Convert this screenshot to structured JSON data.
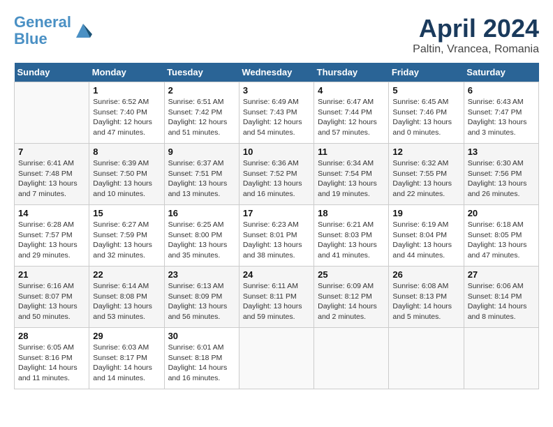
{
  "header": {
    "logo_line1": "General",
    "logo_line2": "Blue",
    "month": "April 2024",
    "location": "Paltin, Vrancea, Romania"
  },
  "weekdays": [
    "Sunday",
    "Monday",
    "Tuesday",
    "Wednesday",
    "Thursday",
    "Friday",
    "Saturday"
  ],
  "weeks": [
    [
      {
        "day": "",
        "info": ""
      },
      {
        "day": "1",
        "info": "Sunrise: 6:52 AM\nSunset: 7:40 PM\nDaylight: 12 hours\nand 47 minutes."
      },
      {
        "day": "2",
        "info": "Sunrise: 6:51 AM\nSunset: 7:42 PM\nDaylight: 12 hours\nand 51 minutes."
      },
      {
        "day": "3",
        "info": "Sunrise: 6:49 AM\nSunset: 7:43 PM\nDaylight: 12 hours\nand 54 minutes."
      },
      {
        "day": "4",
        "info": "Sunrise: 6:47 AM\nSunset: 7:44 PM\nDaylight: 12 hours\nand 57 minutes."
      },
      {
        "day": "5",
        "info": "Sunrise: 6:45 AM\nSunset: 7:46 PM\nDaylight: 13 hours\nand 0 minutes."
      },
      {
        "day": "6",
        "info": "Sunrise: 6:43 AM\nSunset: 7:47 PM\nDaylight: 13 hours\nand 3 minutes."
      }
    ],
    [
      {
        "day": "7",
        "info": "Sunrise: 6:41 AM\nSunset: 7:48 PM\nDaylight: 13 hours\nand 7 minutes."
      },
      {
        "day": "8",
        "info": "Sunrise: 6:39 AM\nSunset: 7:50 PM\nDaylight: 13 hours\nand 10 minutes."
      },
      {
        "day": "9",
        "info": "Sunrise: 6:37 AM\nSunset: 7:51 PM\nDaylight: 13 hours\nand 13 minutes."
      },
      {
        "day": "10",
        "info": "Sunrise: 6:36 AM\nSunset: 7:52 PM\nDaylight: 13 hours\nand 16 minutes."
      },
      {
        "day": "11",
        "info": "Sunrise: 6:34 AM\nSunset: 7:54 PM\nDaylight: 13 hours\nand 19 minutes."
      },
      {
        "day": "12",
        "info": "Sunrise: 6:32 AM\nSunset: 7:55 PM\nDaylight: 13 hours\nand 22 minutes."
      },
      {
        "day": "13",
        "info": "Sunrise: 6:30 AM\nSunset: 7:56 PM\nDaylight: 13 hours\nand 26 minutes."
      }
    ],
    [
      {
        "day": "14",
        "info": "Sunrise: 6:28 AM\nSunset: 7:57 PM\nDaylight: 13 hours\nand 29 minutes."
      },
      {
        "day": "15",
        "info": "Sunrise: 6:27 AM\nSunset: 7:59 PM\nDaylight: 13 hours\nand 32 minutes."
      },
      {
        "day": "16",
        "info": "Sunrise: 6:25 AM\nSunset: 8:00 PM\nDaylight: 13 hours\nand 35 minutes."
      },
      {
        "day": "17",
        "info": "Sunrise: 6:23 AM\nSunset: 8:01 PM\nDaylight: 13 hours\nand 38 minutes."
      },
      {
        "day": "18",
        "info": "Sunrise: 6:21 AM\nSunset: 8:03 PM\nDaylight: 13 hours\nand 41 minutes."
      },
      {
        "day": "19",
        "info": "Sunrise: 6:19 AM\nSunset: 8:04 PM\nDaylight: 13 hours\nand 44 minutes."
      },
      {
        "day": "20",
        "info": "Sunrise: 6:18 AM\nSunset: 8:05 PM\nDaylight: 13 hours\nand 47 minutes."
      }
    ],
    [
      {
        "day": "21",
        "info": "Sunrise: 6:16 AM\nSunset: 8:07 PM\nDaylight: 13 hours\nand 50 minutes."
      },
      {
        "day": "22",
        "info": "Sunrise: 6:14 AM\nSunset: 8:08 PM\nDaylight: 13 hours\nand 53 minutes."
      },
      {
        "day": "23",
        "info": "Sunrise: 6:13 AM\nSunset: 8:09 PM\nDaylight: 13 hours\nand 56 minutes."
      },
      {
        "day": "24",
        "info": "Sunrise: 6:11 AM\nSunset: 8:11 PM\nDaylight: 13 hours\nand 59 minutes."
      },
      {
        "day": "25",
        "info": "Sunrise: 6:09 AM\nSunset: 8:12 PM\nDaylight: 14 hours\nand 2 minutes."
      },
      {
        "day": "26",
        "info": "Sunrise: 6:08 AM\nSunset: 8:13 PM\nDaylight: 14 hours\nand 5 minutes."
      },
      {
        "day": "27",
        "info": "Sunrise: 6:06 AM\nSunset: 8:14 PM\nDaylight: 14 hours\nand 8 minutes."
      }
    ],
    [
      {
        "day": "28",
        "info": "Sunrise: 6:05 AM\nSunset: 8:16 PM\nDaylight: 14 hours\nand 11 minutes."
      },
      {
        "day": "29",
        "info": "Sunrise: 6:03 AM\nSunset: 8:17 PM\nDaylight: 14 hours\nand 14 minutes."
      },
      {
        "day": "30",
        "info": "Sunrise: 6:01 AM\nSunset: 8:18 PM\nDaylight: 14 hours\nand 16 minutes."
      },
      {
        "day": "",
        "info": ""
      },
      {
        "day": "",
        "info": ""
      },
      {
        "day": "",
        "info": ""
      },
      {
        "day": "",
        "info": ""
      }
    ]
  ]
}
